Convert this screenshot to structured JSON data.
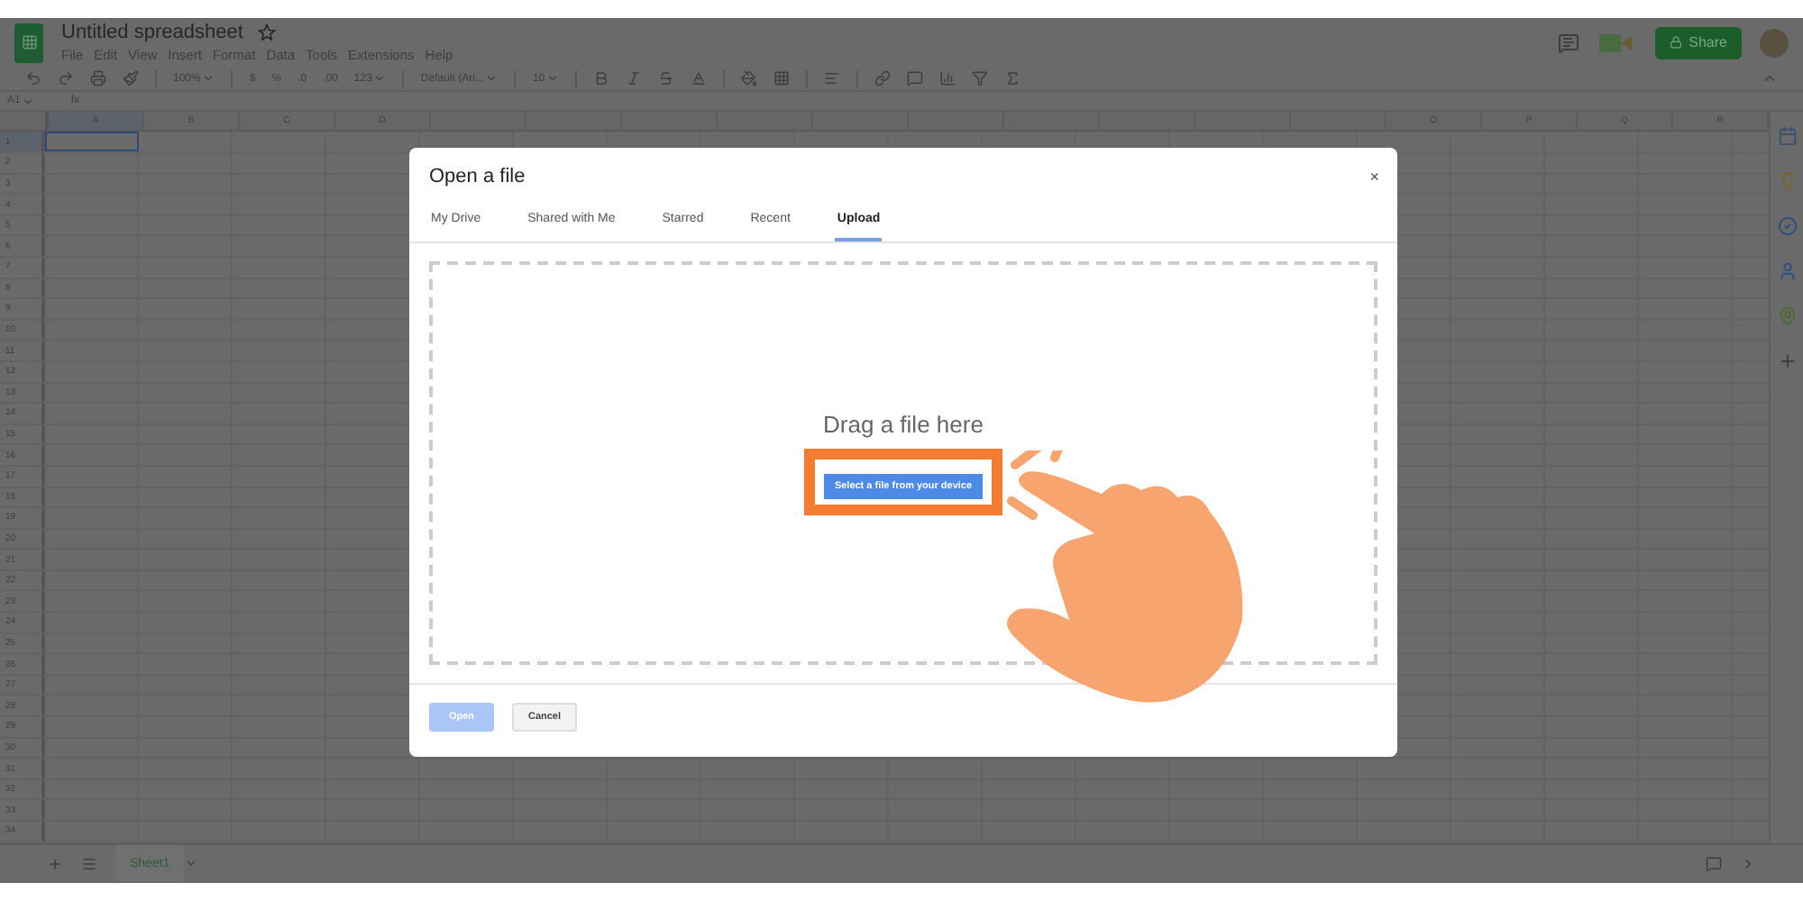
{
  "app": {
    "title": "Untitled spreadsheet",
    "starred": false,
    "menu": [
      "File",
      "Edit",
      "View",
      "Insert",
      "Format",
      "Data",
      "Tools",
      "Extensions",
      "Help"
    ],
    "share": "Share"
  },
  "toolbar": {
    "zoom": "100%",
    "currency": "$",
    "percent": "%",
    "decrease_decimals": ".0",
    "increase_decimals": ".00",
    "number_format": "123",
    "font": "Default (Ari...",
    "font_size": "10"
  },
  "formula_bar": {
    "cell": "A1",
    "fx": "fx"
  },
  "grid": {
    "columns_left": [
      "A",
      "B",
      "C",
      "D"
    ],
    "columns_right": [
      "O",
      "P",
      "Q",
      "R"
    ],
    "rows": [
      "1",
      "2",
      "3",
      "4",
      "5",
      "6",
      "7",
      "8",
      "9",
      "10",
      "11",
      "12",
      "13",
      "14",
      "15",
      "16",
      "17",
      "18",
      "19",
      "20",
      "21",
      "22",
      "23",
      "24",
      "25",
      "26",
      "27",
      "28",
      "29",
      "30",
      "31",
      "32",
      "33",
      "34"
    ]
  },
  "sheets": [
    {
      "label": "Sheet1",
      "selected": true
    }
  ],
  "dialog": {
    "title": "Open a file",
    "close": "×",
    "tabs": [
      {
        "label": "My Drive",
        "selected": false
      },
      {
        "label": "Shared with Me",
        "selected": false
      },
      {
        "label": "Starred",
        "selected": false
      },
      {
        "label": "Recent",
        "selected": false
      },
      {
        "label": "Upload",
        "selected": true
      }
    ],
    "drop_text": "Drag a file here",
    "select_button": "Select a file from your device",
    "buttons": [
      {
        "label": "Open",
        "disabled": true,
        "kind": "primary"
      },
      {
        "label": "Cancel",
        "disabled": false,
        "kind": "secondary"
      }
    ]
  }
}
